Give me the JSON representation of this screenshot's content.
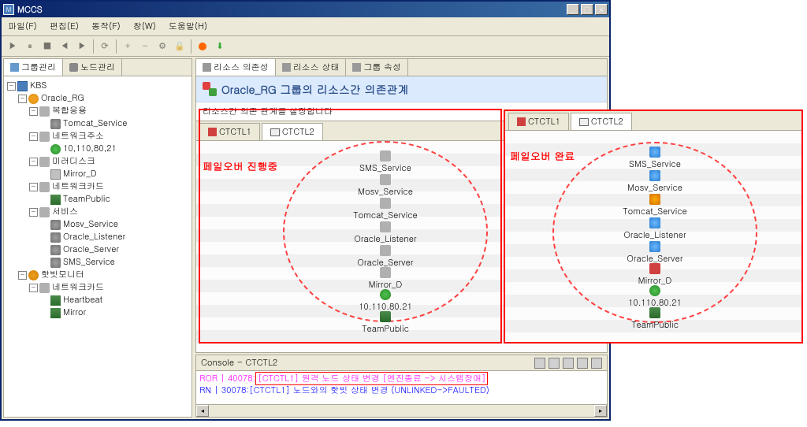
{
  "window": {
    "title": "MCCS"
  },
  "menu": {
    "file": "파일(F)",
    "edit": "편집(E)",
    "action": "동작(F)",
    "window": "창(W)",
    "help": "도움말(H)"
  },
  "panel_tabs": {
    "group_mgmt": "그룹관리",
    "node_mgmt": "노드관리"
  },
  "tree": {
    "root": "KBS",
    "oracle_rg": "Oracle_RG",
    "composite": "복합응용",
    "tomcat_service": "Tomcat_Service",
    "network_addr": "네트워크주소",
    "ip_addr": "10,110,80,21",
    "mirror_disk": "미러디스크",
    "mirror_d": "Mirror_D",
    "network_card": "네트워크카드",
    "team_public": "TeamPublic",
    "service": "서비스",
    "mosv_service": "Mosv_Service",
    "oracle_listener": "Oracle_Listener",
    "oracle_server": "Oracle_Server",
    "sms_service": "SMS_Service",
    "heartbeat_mon": "핫빗모니터",
    "heartbeat": "Heartbeat",
    "mirror": "Mirror"
  },
  "top_tabs": {
    "dependency": "리소스 의존성",
    "state": "리소스 상태",
    "props": "그룹 속성"
  },
  "header": {
    "title": "Oracle_RG 그룹의 리소스간 의존관계",
    "desc": "리소스간 의존 관계를 설정합니다"
  },
  "sub_tabs": {
    "ctctl1": "CTCTL1",
    "ctctl2": "CTCTL2"
  },
  "left_canvas": {
    "label": "페일오버 진행중",
    "items": [
      "SMS_Service",
      "Mosv_Service",
      "Tomcat_Service",
      "Oracle_Listener",
      "Oracle_Server",
      "Mirror_D",
      "10.110.80.21",
      "TeamPublic"
    ]
  },
  "right_canvas": {
    "label": "페일오버 완료",
    "items": [
      "SMS_Service",
      "Mosv_Service",
      "Tomcat_Service",
      "Oracle_Listener",
      "Oracle_Server",
      "Mirror_D",
      "10.110.80.21",
      "TeamPublic"
    ]
  },
  "console": {
    "title": "Console - CTCTL2",
    "line1_pre": "ROR | 40078:",
    "line1_box": "[CTCTL1] 원격 노드 상태 변경 [엔진종료 -> 시스템장애]",
    "line2": "RN  | 30078:[CTCTL1] 노드와의 핫빗 상태 변경 (UNLINKED->FAULTED)"
  }
}
